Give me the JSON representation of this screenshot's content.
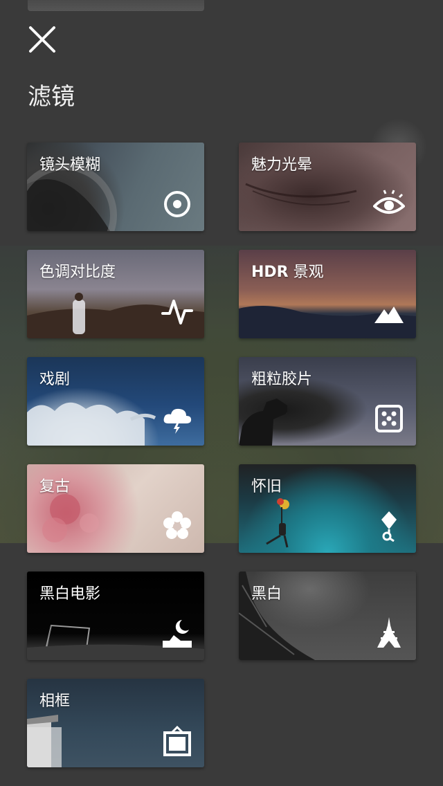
{
  "title": "滤镜",
  "close_icon": "close-icon",
  "filters": [
    {
      "label": "镜头模糊",
      "icon": "target-icon"
    },
    {
      "label": "魅力光晕",
      "icon": "eye-icon"
    },
    {
      "label": "色调对比度",
      "icon": "pulse-icon"
    },
    {
      "label_prefix": "HDR",
      "label_rest": " 景观",
      "icon": "mountain-icon"
    },
    {
      "label": "戏剧",
      "icon": "storm-cloud-icon"
    },
    {
      "label": "粗粒胶片",
      "icon": "dice-icon"
    },
    {
      "label": "复古",
      "icon": "flower-icon"
    },
    {
      "label": "怀旧",
      "icon": "kite-icon"
    },
    {
      "label": "黑白电影",
      "icon": "moon-icon"
    },
    {
      "label": "黑白",
      "icon": "eiffel-tower-icon"
    },
    {
      "label": "相框",
      "icon": "frame-icon"
    }
  ],
  "colors": {
    "background": "#3a3a3a",
    "text": "#ffffff"
  }
}
